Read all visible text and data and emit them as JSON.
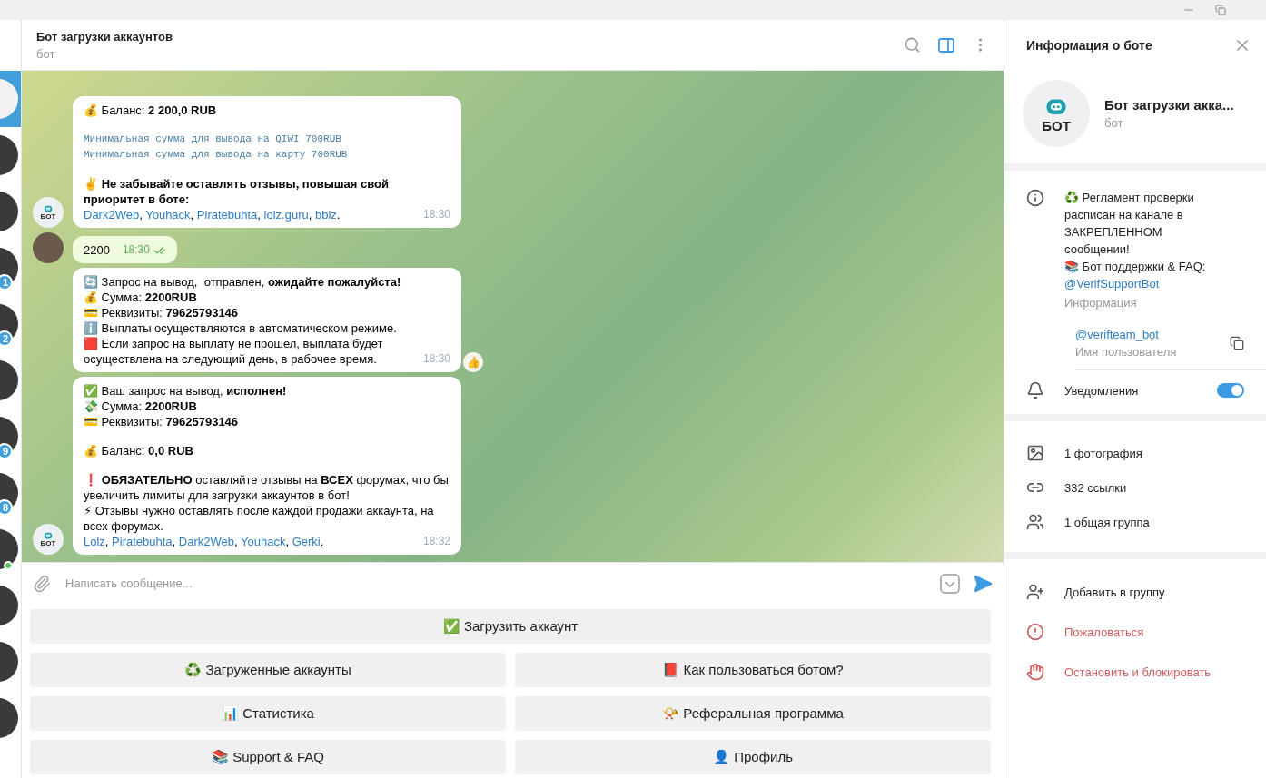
{
  "chat_list": [
    {
      "selected": true,
      "online": false
    },
    {
      "selected": false,
      "online": false
    },
    {
      "selected": false,
      "online": false
    },
    {
      "selected": false,
      "badge": "1",
      "online": false
    },
    {
      "selected": false,
      "badge": "2",
      "online": false
    },
    {
      "selected": false,
      "online": false
    },
    {
      "selected": false,
      "badge": "9",
      "online": false
    },
    {
      "selected": false,
      "badge": "8",
      "online": false
    },
    {
      "selected": false,
      "online": true
    },
    {
      "selected": false,
      "online": false
    },
    {
      "selected": false,
      "online": false
    },
    {
      "selected": false,
      "online": false
    }
  ],
  "chat_header": {
    "title": "Бот загрузки аккаунтов",
    "subtitle": "бот",
    "side_panel_open": true
  },
  "messages": [
    {
      "kind": "incoming",
      "avatar_text": "БОТ",
      "time": "18:30",
      "paragraphs": [
        [
          {
            "kind": "text",
            "text": "💰 Баланс: **2 200,0 RUB**"
          }
        ],
        [
          {
            "kind": "code",
            "text": "Минимальная сумма для вывода на QIWI 700RUB"
          },
          {
            "kind": "code",
            "text": "Минимальная сумма для вывода на карту 700RUB"
          }
        ],
        [
          {
            "kind": "text",
            "text": "✌️ **Не забывайте оставлять отзывы, повышая свой приоритет в боте:**"
          },
          {
            "kind": "links",
            "links": [
              {
                "text": "Dark2Web",
                "after": ", "
              },
              {
                "text": "Youhack",
                "after": ", "
              },
              {
                "text": "Piratebuhta",
                "after": ", "
              },
              {
                "text": "lolz.guru",
                "after": ", "
              },
              {
                "text": "bbiz",
                "after": "."
              }
            ]
          }
        ]
      ]
    },
    {
      "kind": "outgoing",
      "time": "18:30",
      "read": true,
      "paragraphs": [
        [
          {
            "kind": "text",
            "text": "2200"
          }
        ]
      ]
    },
    {
      "kind": "incoming",
      "time": "18:30",
      "reaction": "👍",
      "paragraphs": [
        [
          {
            "kind": "text",
            "text": "🔄 Запрос на вывод,  отправлен, **ожидайте пожалуйста!**"
          },
          {
            "kind": "text",
            "text": "💰 Сумма: **2200RUB**"
          },
          {
            "kind": "text",
            "text": "💳 Реквизиты: **79625793146**"
          },
          {
            "kind": "text",
            "text": "ℹ️ Выплаты осуществляются в автоматическом режиме."
          },
          {
            "kind": "text",
            "text": "🟥 Если запрос на выплату не прошел, выплата будет осуществлена на следующий день, в рабочее время."
          }
        ]
      ]
    },
    {
      "kind": "incoming",
      "avatar_text": "БОТ",
      "time": "18:32",
      "paragraphs": [
        [
          {
            "kind": "text",
            "text": "✅ Ваш запрос на вывод, **исполнен!**"
          },
          {
            "kind": "text",
            "text": "💸 Сумма: **2200RUB**"
          },
          {
            "kind": "text",
            "text": "💳 Реквизиты: **79625793146**"
          }
        ],
        [
          {
            "kind": "text",
            "text": "💰 Баланс: **0,0 RUB**"
          }
        ],
        [
          {
            "kind": "text",
            "text": "❗ **ОБЯЗАТЕЛЬНО** оставляйте отзывы на **ВСЕХ** форумах, что бы увеличить лимиты для загрузки аккаунтов в бот!"
          },
          {
            "kind": "text",
            "text": "⚡ Отзывы нужно оставлять после каждой продажи аккаунта, на всех форумах."
          },
          {
            "kind": "links",
            "links": [
              {
                "text": "Lolz",
                "after": ", "
              },
              {
                "text": "Piratebuhta",
                "after": ", "
              },
              {
                "text": "Dark2Web",
                "after": ", "
              },
              {
                "text": "Youhack",
                "after": ", "
              },
              {
                "text": "Gerki",
                "after": "."
              }
            ]
          }
        ]
      ]
    }
  ],
  "composer": {
    "placeholder": "Написать сообщение..."
  },
  "keyboard": [
    [
      "✅ Загрузить аккаунт"
    ],
    [
      "♻️ Загруженные аккаунты",
      "📕 Как пользоваться ботом?"
    ],
    [
      "📊 Статистика",
      "📯 Реферальная программа"
    ],
    [
      "📚 Support & FAQ",
      "👤 Профиль"
    ]
  ],
  "info_panel": {
    "title": "Информация о боте",
    "avatar_text": "БОТ",
    "name": "Бот загрузки акка...",
    "subtitle": "бот",
    "bio_lines": [
      "♻️ Регламент проверки расписан на канале в ЗАКРЕПЛЕННОМ сообщении!",
      "📚 Бот поддержки & FAQ:"
    ],
    "bio_link": "@VerifSupportBot",
    "bio_label": "Информация",
    "username": "@verifteam_bot",
    "username_label": "Имя пользователя",
    "notifications": {
      "label": "Уведомления",
      "on": true
    },
    "media": [
      {
        "kind": "photos",
        "label": "1 фотография"
      },
      {
        "kind": "links",
        "label": "332 ссылки"
      },
      {
        "kind": "groups",
        "label": "1 общая группа"
      }
    ],
    "actions": [
      {
        "kind": "add",
        "label": "Добавить в группу",
        "danger": false
      },
      {
        "kind": "report",
        "label": "Пожаловаться",
        "danger": true
      },
      {
        "kind": "block",
        "label": "Остановить и блокировать",
        "danger": true
      }
    ]
  }
}
